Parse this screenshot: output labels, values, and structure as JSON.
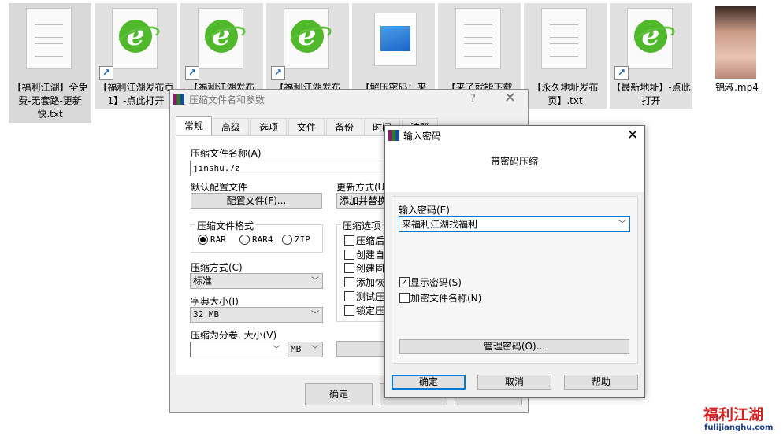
{
  "desktop": {
    "icons": [
      {
        "label": "【福利江湖】全免费-无套路-更新快.txt",
        "icon": "text-file-icon"
      },
      {
        "label": "【福利江湖发布页1】-点此打开",
        "icon": "ie-shortcut-icon"
      },
      {
        "label": "【福利江湖发布",
        "icon": "ie-shortcut-icon"
      },
      {
        "label": "【福利江湖发布",
        "icon": "ie-shortcut-icon"
      },
      {
        "label": "【解压密码：来",
        "icon": "image-file-icon"
      },
      {
        "label": "【来了就能下载",
        "icon": "text-file-icon"
      },
      {
        "label": "【永久地址发布页】.txt",
        "icon": "text-file-icon"
      },
      {
        "label": "【最新地址】-点此打开",
        "icon": "ie-shortcut-icon"
      },
      {
        "label": "锦淑.mp4",
        "icon": "video-thumbnail"
      }
    ]
  },
  "archive_dialog": {
    "title": "压缩文件名和参数",
    "help": "?",
    "tabs": [
      "常规",
      "高级",
      "选项",
      "文件",
      "备份",
      "时间",
      "注释"
    ],
    "archive_name_label": "压缩文件名称(A)",
    "archive_name_value": "jinshu.7z",
    "profile_label": "默认配置文件",
    "profile_button": "配置文件(F)...",
    "update_label": "更新方式(U",
    "update_value": "添加并替换",
    "format_group": "压缩文件格式",
    "formats": [
      "RAR",
      "RAR4",
      "ZIP"
    ],
    "options_group": "压缩选项",
    "options": [
      "压缩后",
      "创建自",
      "创建固",
      "添加恢",
      "测试压",
      "锁定压"
    ],
    "method_label": "压缩方式(C)",
    "method_value": "标准",
    "dict_label": "字典大小(I)",
    "dict_value": "32 MB",
    "split_label": "压缩为分卷, 大小(V)",
    "split_value": "",
    "split_unit": "MB",
    "ok": "确定"
  },
  "password_dialog": {
    "title": "输入密码",
    "heading": "带密码压缩",
    "password_label": "输入密码(E)",
    "password_value": "来福利江湖找福利",
    "show_password": "显示密码(S)",
    "encrypt_names": "加密文件名称(N)",
    "manage_button": "管理密码(O)...",
    "ok": "确定",
    "cancel": "取消",
    "help": "帮助"
  },
  "watermark": {
    "line1": "福利江湖",
    "line2": "fulijianghu.com"
  },
  "colors": {
    "accent": "#0078d7",
    "watermark_red": "#d92020",
    "watermark_blue": "#1a5fb4"
  }
}
